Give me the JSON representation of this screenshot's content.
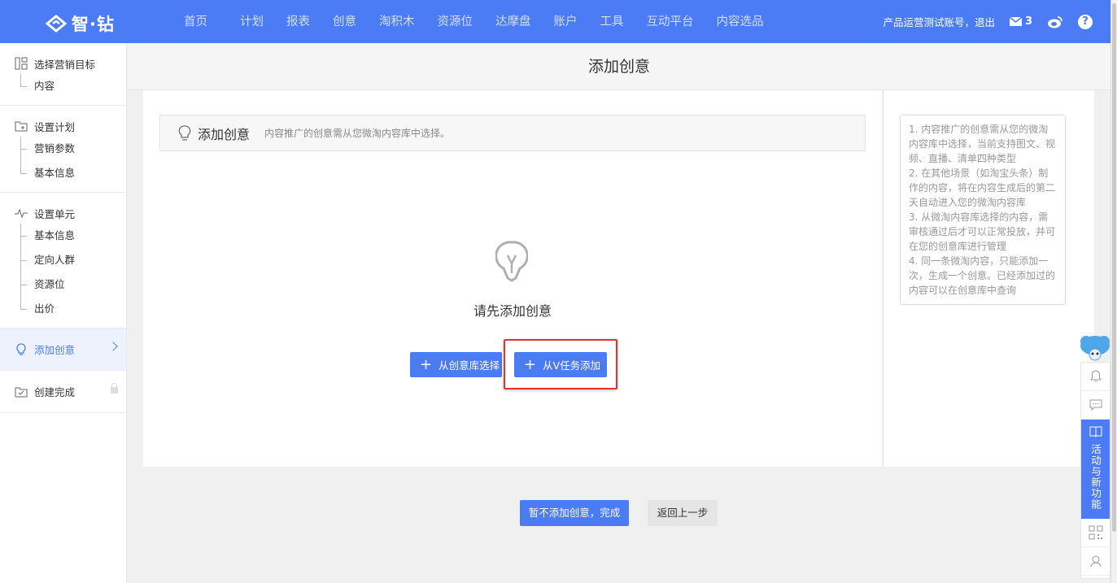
{
  "brand": {
    "name": "智·钻"
  },
  "nav": [
    "首页",
    "计划",
    "报表",
    "创意",
    "淘积木",
    "资源位",
    "达摩盘",
    "账户",
    "工具",
    "互动平台",
    "内容选品"
  ],
  "user": {
    "account_text": "产品运营测试账号，退出",
    "mail_count": "3",
    "help": "?"
  },
  "sidebar": {
    "groups": [
      {
        "title": "选择营销目标",
        "items": [
          "内容"
        ]
      },
      {
        "title": "设置计划",
        "items": [
          "营销参数",
          "基本信息"
        ]
      },
      {
        "title": "设置单元",
        "items": [
          "基本信息",
          "定向人群",
          "资源位",
          "出价"
        ]
      }
    ],
    "active": "添加创意",
    "done": "创建完成"
  },
  "page": {
    "title": "添加创意",
    "bar_title": "添加创意",
    "bar_desc": "内容推广的创意需从您微淘内容库中选择。",
    "empty_text": "请先添加创意",
    "btn_library": "从创意库选择",
    "btn_vtask": "从V任务添加",
    "btn_finish": "暂不添加创意，完成",
    "btn_back": "返回上一步"
  },
  "tips": [
    "1. 内容推广的创意需从您的微淘内容库中选择，当前支持图文、视频、直播、清单四种类型",
    "2. 在其他场景（如淘宝头条）制作的内容，将在内容生成后的第二天自动进入您的微淘内容库",
    "3. 从微淘内容库选择的内容，需审核通过后才可以正常投放，并可在您的创意库进行管理",
    "4. 同一条微淘内容，只能添加一次，生成一个创意。已经添加过的内容可以在创意库中查询"
  ],
  "float": {
    "activity_label": "活动与新功能"
  },
  "colors": {
    "brand_blue": "#4b7bf5",
    "highlight_red": "#e0352b"
  }
}
